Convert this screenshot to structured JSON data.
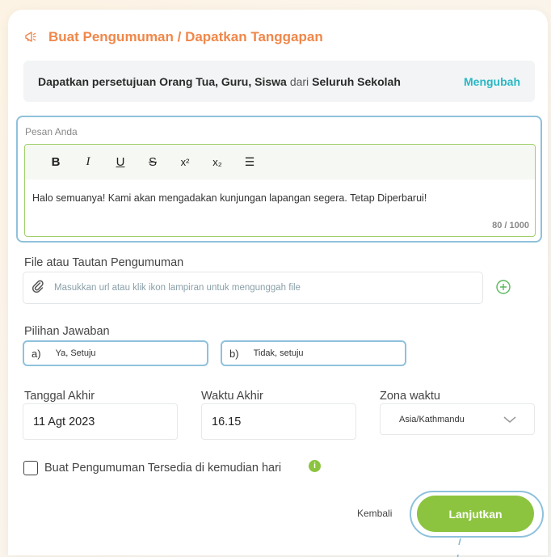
{
  "header": {
    "title": "Buat Pengumuman / Dapatkan Tanggapan",
    "icon": "megaphone-icon"
  },
  "audience": {
    "part1": "Dapatkan persetujuan Orang Tua, Guru, Siswa",
    "connector": "dari",
    "part2": "Seluruh Sekolah",
    "change_label": "Mengubah"
  },
  "message": {
    "label": "Pesan Anda",
    "toolbar": {
      "bold": "B",
      "italic": "I",
      "underline": "U",
      "strike": "S",
      "superscript": "x²",
      "subscript": "x₂",
      "list": "☰"
    },
    "text": "Halo semuanya! Kami akan mengadakan kunjungan lapangan segera. Tetap Diperbarui!",
    "counter": "80 / 1000"
  },
  "attachment": {
    "label": "File atau Tautan Pengumuman",
    "placeholder": "Masukkan url atau klik ikon lampiran untuk mengunggah file"
  },
  "answers": {
    "label": "Pilihan Jawaban",
    "options": [
      {
        "letter": "a)",
        "value": "Ya, Setuju"
      },
      {
        "letter": "b)",
        "value": "Tidak, setuju"
      }
    ]
  },
  "schedule": {
    "date_label": "Tanggal Akhir",
    "date_value": "11 Agt 2023",
    "time_label": "Waktu Akhir",
    "time_value": "16.15",
    "tz_label": "Zona waktu",
    "tz_value": "Asia/Kathmandu"
  },
  "later": {
    "label": "Buat Pengumuman Tersedia di kemudian hari",
    "checked": false
  },
  "actions": {
    "back_label": "Kembali",
    "continue_label": "Lanjutkan"
  },
  "colors": {
    "accent_orange": "#f0874a",
    "accent_teal": "#2ab7c4",
    "accent_green": "#8cc43f",
    "focus_blue": "#8fc1dc"
  }
}
